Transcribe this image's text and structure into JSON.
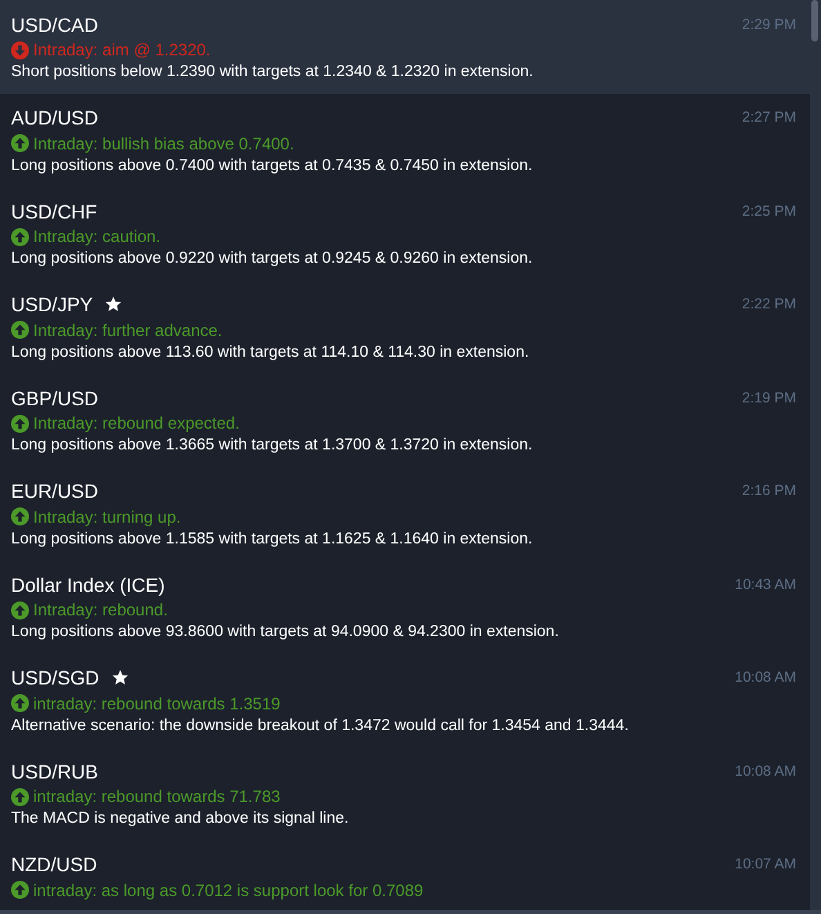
{
  "alerts": [
    {
      "symbol": "USD/CAD",
      "starred": false,
      "time": "2:29 PM",
      "kind": "down",
      "signal": "Intraday: aim @ 1.2320.",
      "text": "Short positions below 1.2390 with targets at 1.2340 & 1.2320 in extension.",
      "selected": true
    },
    {
      "symbol": "AUD/USD",
      "starred": false,
      "time": "2:27 PM",
      "kind": "up",
      "signal": "Intraday: bullish bias above 0.7400.",
      "text": "Long positions above 0.7400 with targets at 0.7435 & 0.7450 in extension.",
      "selected": false
    },
    {
      "symbol": "USD/CHF",
      "starred": false,
      "time": "2:25 PM",
      "kind": "up",
      "signal": "Intraday: caution.",
      "text": "Long positions above 0.9220 with targets at 0.9245 & 0.9260 in extension.",
      "selected": false
    },
    {
      "symbol": "USD/JPY",
      "starred": true,
      "time": "2:22 PM",
      "kind": "up",
      "signal": "Intraday: further advance.",
      "text": "Long positions above 113.60 with targets at 114.10 & 114.30 in extension.",
      "selected": false
    },
    {
      "symbol": "GBP/USD",
      "starred": false,
      "time": "2:19 PM",
      "kind": "up",
      "signal": "Intraday: rebound expected.",
      "text": "Long positions above 1.3665 with targets at 1.3700 & 1.3720 in extension.",
      "selected": false
    },
    {
      "symbol": "EUR/USD",
      "starred": false,
      "time": "2:16 PM",
      "kind": "up",
      "signal": "Intraday: turning up.",
      "text": "Long positions above 1.1585 with targets at 1.1625 & 1.1640 in extension.",
      "selected": false
    },
    {
      "symbol": "Dollar Index (ICE)",
      "starred": false,
      "time": "10:43 AM",
      "kind": "up",
      "signal": "Intraday: rebound.",
      "text": "Long positions above 93.8600 with targets at 94.0900 & 94.2300 in extension.",
      "selected": false
    },
    {
      "symbol": "USD/SGD",
      "starred": true,
      "time": "10:08 AM",
      "kind": "up",
      "signal": "intraday: rebound towards 1.3519",
      "text": "Alternative scenario: the downside breakout of 1.3472 would call for 1.3454 and 1.3444.",
      "selected": false
    },
    {
      "symbol": "USD/RUB",
      "starred": false,
      "time": "10:08 AM",
      "kind": "up",
      "signal": "intraday: rebound towards 71.783",
      "text": "The MACD is negative and above its signal line.",
      "selected": false
    },
    {
      "symbol": "NZD/USD",
      "starred": false,
      "time": "10:07 AM",
      "kind": "up",
      "signal": "intraday: as long as 0.7012 is support look for 0.7089",
      "selected": false
    }
  ]
}
